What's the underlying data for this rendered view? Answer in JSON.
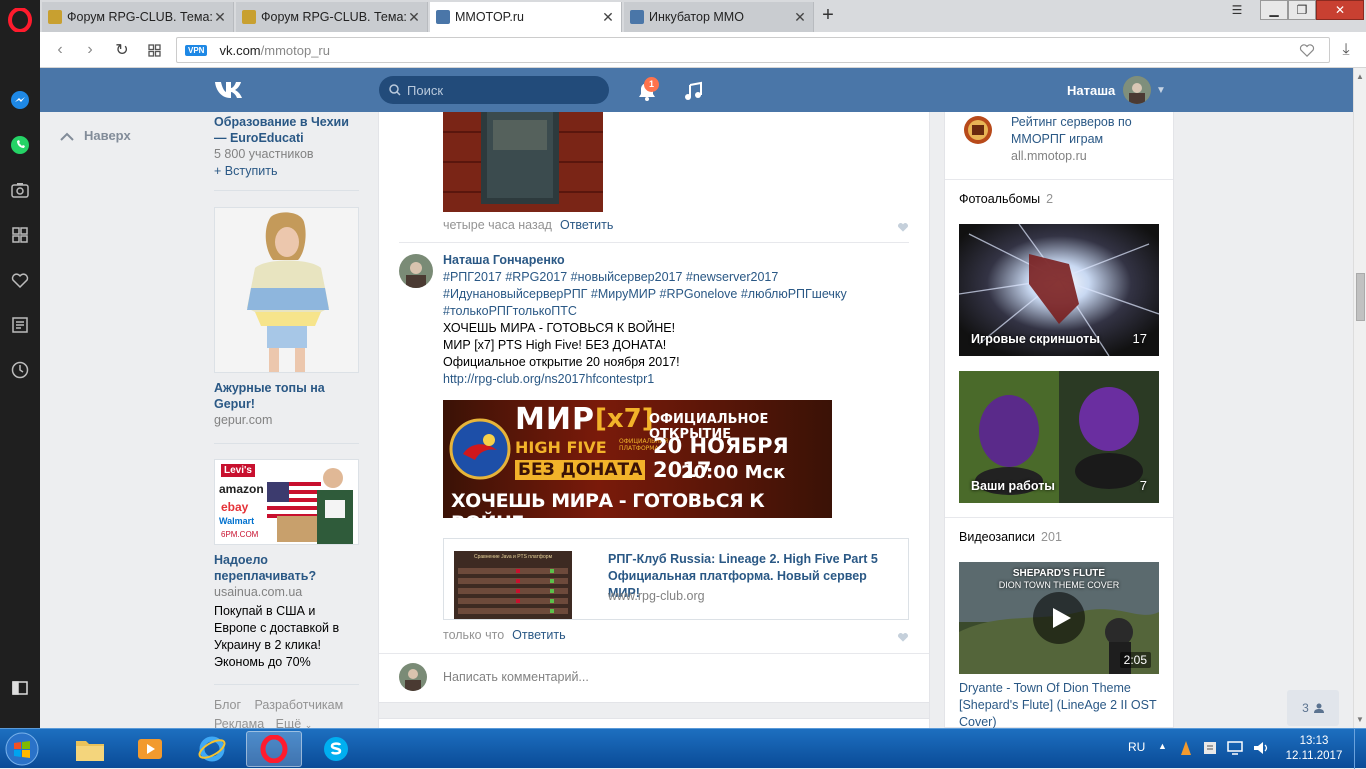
{
  "browser": {
    "tabs": [
      {
        "title": "Форум RPG-CLUB. Тема: Мир",
        "favicon_color": "#c8a030"
      },
      {
        "title": "Форум RPG-CLUB. Тема: Мир",
        "favicon_color": "#c8a030"
      },
      {
        "title": "MMOTOP.ru",
        "favicon_color": "#4a76a8"
      },
      {
        "title": "Инкубатор MMO",
        "favicon_color": "#4a76a8"
      }
    ],
    "vpn_label": "VPN",
    "url_host": "vk.com",
    "url_path": "/mmotop_ru"
  },
  "header": {
    "search_placeholder": "Поиск",
    "notification_count": "1",
    "username": "Наташа"
  },
  "left": {
    "up_label": "Наверх",
    "group": {
      "title": "Образование в Чехии — EuroEducati",
      "members": "5 800 участников",
      "join": "+ Вступить"
    },
    "ad1": {
      "title": "Ажурные топы на Gepur!",
      "domain": "gepur.com"
    },
    "ad2": {
      "title": "Надоело переплачивать?",
      "domain": "usainua.com.ua",
      "text": "Покупай в США и Европе с доставкой в Украину в 2 клика! Экономь до 70%",
      "brands": [
        "Levi's",
        "amazon",
        "ebay",
        "Walmart",
        "6PM.COM"
      ]
    },
    "footer": {
      "blog": "Блог",
      "devs": "Разработчикам",
      "ads": "Реклама",
      "more": "Ещё"
    }
  },
  "feed": {
    "comment1": {
      "time": "четыре часа назад",
      "reply": "Ответить"
    },
    "comment2": {
      "author": "Наташа Гончаренко",
      "hashtags1": "#РПГ2017 #RPG2017 #новыйсервер2017 #newserver2017",
      "hashtags2": "#ИдунановыйсерверРПГ #МируМИР #RPGonelove #люблюРПГшечку",
      "hashtags3": "#толькоРПГтолькоПТС",
      "line1": "ХОЧЕШЬ МИРА - ГОТОВЬСЯ К ВОЙНЕ!",
      "line2": "МИР [x7] PTS High Five! БЕЗ ДОНАТА!",
      "line3": "Официальное открытие 20 ноября 2017!",
      "link": "http://rpg-club.org/ns2017hfcontestpr1",
      "banner": {
        "mir": "МИР",
        "x7": "[x7]",
        "official": "ОФИЦИАЛЬНОЕ ОТКРЫТИЕ",
        "highfive": "HIGH FIVE",
        "platform": "ОФИЦИАЛЬНАЯ ПЛАТФОРМА",
        "date": "20 НОЯБРЯ 2017",
        "nodonate": "БЕЗ ДОНАТА",
        "time": "20:00 Мск",
        "slogan": "ХОЧЕШЬ МИРА - ГОТОВЬСЯ К ВОЙНЕ"
      },
      "card": {
        "title": "РПГ-Клуб Russia: Lineage 2. High Five Part 5 Официальная платформа. Новый сервер МИР!",
        "domain": "www.rpg-club.org",
        "thumb_heading": "Сравнение Java и PTS платформ"
      },
      "time": "только что",
      "reply": "Ответить"
    },
    "comment_placeholder": "Написать комментарий..."
  },
  "right": {
    "link": {
      "title": "Рейтинг серверов по ММОРПГ играм",
      "domain": "all.mmotop.ru"
    },
    "albums_title": "Фотоальбомы",
    "albums_count": "2",
    "albums": [
      {
        "name": "Игровые скриншоты",
        "count": "17"
      },
      {
        "name": "Ваши работы",
        "count": "7"
      }
    ],
    "videos_title": "Видеозаписи",
    "videos_count": "201",
    "video": {
      "overlay1": "SHEPARD'S FLUTE",
      "overlay2": "DION TOWN THEME COVER",
      "duration": "2:05",
      "title": "Dryante - Town Of Dion Theme [Shepard's Flute] (LineAge 2 II OST Cover)"
    },
    "friends_count": "3"
  },
  "taskbar": {
    "lang": "RU",
    "time": "13:13",
    "date": "12.11.2017"
  }
}
